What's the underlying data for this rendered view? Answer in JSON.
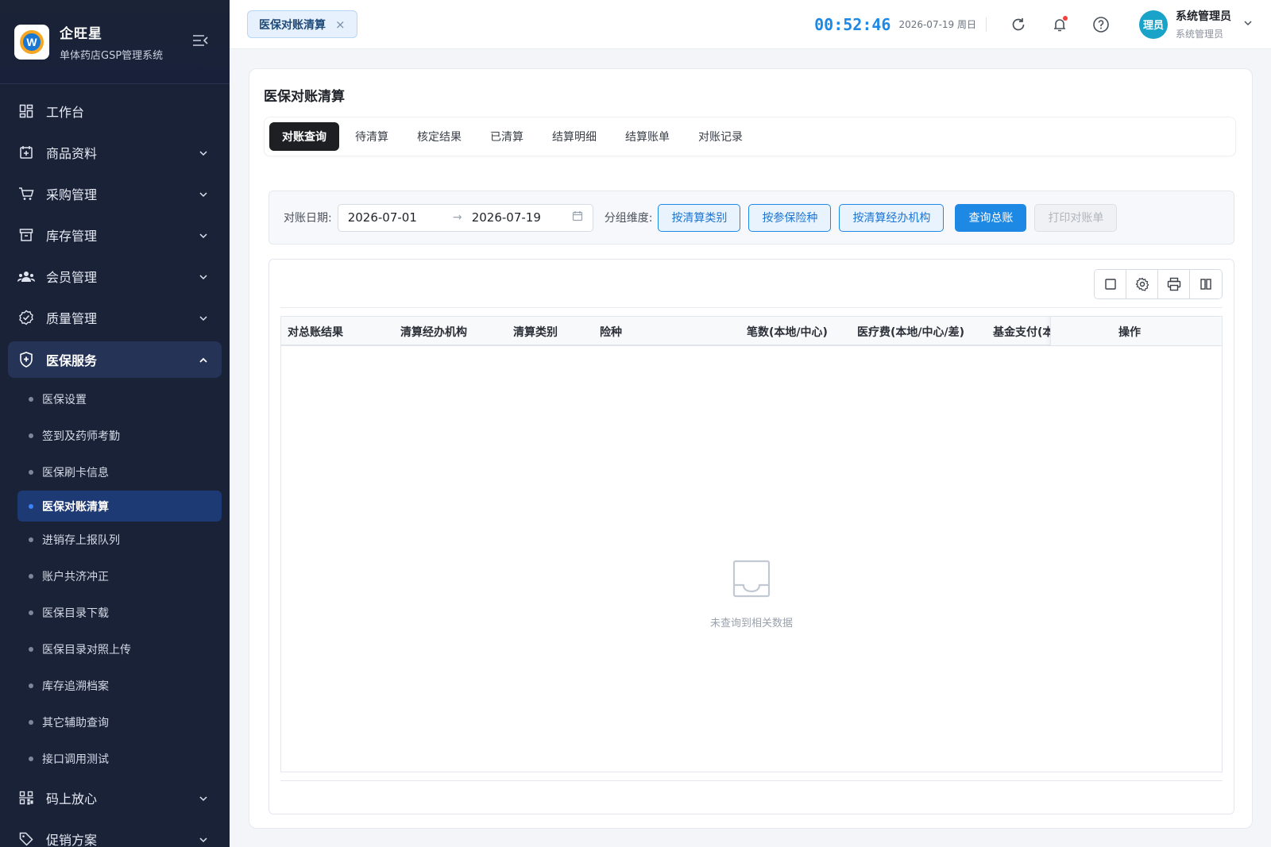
{
  "brand": {
    "title": "企旺星",
    "subtitle": "单体药店GSP管理系统",
    "logo_letter": "W"
  },
  "sidebar": {
    "items": [
      {
        "label": "工作台",
        "icon": "dashboard-icon"
      },
      {
        "label": "商品资料",
        "icon": "product-icon"
      },
      {
        "label": "采购管理",
        "icon": "cart-icon"
      },
      {
        "label": "库存管理",
        "icon": "inventory-icon"
      },
      {
        "label": "会员管理",
        "icon": "members-icon"
      },
      {
        "label": "质量管理",
        "icon": "quality-icon"
      },
      {
        "label": "医保服务",
        "icon": "shield-icon"
      },
      {
        "label": "码上放心",
        "icon": "qrcode-icon"
      },
      {
        "label": "促销方案",
        "icon": "tag-icon"
      }
    ],
    "submenu": [
      "医保设置",
      "签到及药师考勤",
      "医保刷卡信息",
      "医保对账清算",
      "进销存上报队列",
      "账户共济冲正",
      "医保目录下载",
      "医保目录对照上传",
      "库存追溯档案",
      "其它辅助查询",
      "接口调用测试"
    ]
  },
  "topbar": {
    "open_tab": "医保对账清算",
    "close_symbol": "×",
    "clock": "00:52:46",
    "date": "2026-07-19 周日",
    "avatar_text": "理员",
    "user_name": "系统管理员",
    "user_role": "系统管理员"
  },
  "page": {
    "title": "医保对账清算",
    "tabs": [
      "对账查询",
      "待清算",
      "核定结果",
      "已清算",
      "结算明细",
      "结算账单",
      "对账记录"
    ]
  },
  "filter": {
    "date_label": "对账日期:",
    "start_date": "2026-07-01",
    "range_arrow": "→",
    "end_date": "2026-07-19",
    "group_label": "分组维度:",
    "group_buttons": [
      "按清算类别",
      "按参保险种",
      "按清算经办机构"
    ],
    "query_button": "查询总账",
    "print_button": "打印对账单"
  },
  "table": {
    "columns": [
      "对总账结果",
      "清算经办机构",
      "清算类别",
      "险种",
      "笔数(本地/中心)",
      "医疗费(本地/中心/差)",
      "基金支付(本地/中心/差)",
      "操作"
    ],
    "empty_text": "未查询到相关数据"
  },
  "colors": {
    "sidebar_bg": "#1a2238",
    "accent": "#1e88e5",
    "active_tab": "#1d1f23",
    "active_sub_bg": "#1e3a74"
  }
}
